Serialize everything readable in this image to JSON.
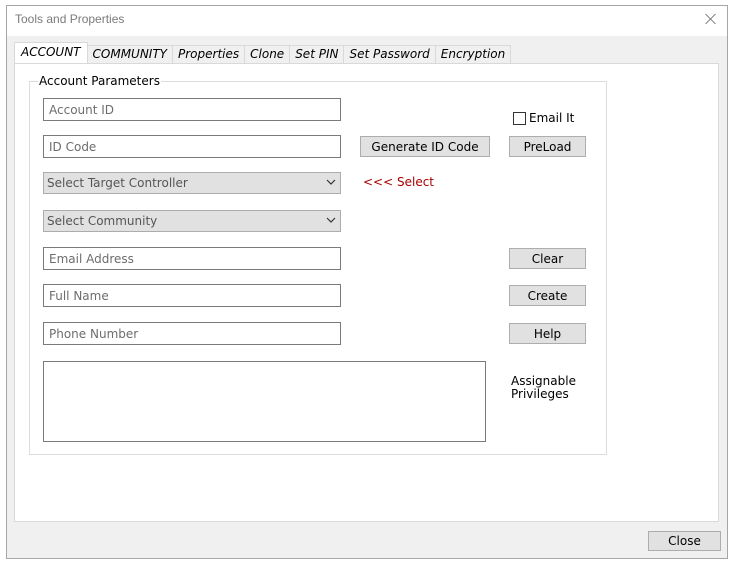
{
  "window": {
    "title": "Tools and Properties",
    "close_button": "Close"
  },
  "tabs": [
    {
      "label": "ACCOUNT",
      "active": true
    },
    {
      "label": "COMMUNITY"
    },
    {
      "label": "Properties"
    },
    {
      "label": "Clone"
    },
    {
      "label": "Set PIN"
    },
    {
      "label": "Set Password"
    },
    {
      "label": "Encryption"
    }
  ],
  "account": {
    "group_label": "Account Parameters",
    "account_id_placeholder": "Account ID",
    "id_code_placeholder": "ID Code",
    "target_controller": "Select Target Controller",
    "community": "Select Community",
    "email_placeholder": "Email Address",
    "full_name_placeholder": "Full Name",
    "phone_placeholder": "Phone Number",
    "email_it_label": "Email It",
    "generate_button": "Generate ID Code",
    "preload_button": "PreLoad",
    "select_hint": "<<< Select",
    "clear_button": "Clear",
    "create_button": "Create",
    "help_button": "Help",
    "privileges_label_1": "Assignable",
    "privileges_label_2": "Privileges"
  },
  "colors": {
    "hint_red": "#a60000",
    "button_bg": "#e1e1e1"
  }
}
